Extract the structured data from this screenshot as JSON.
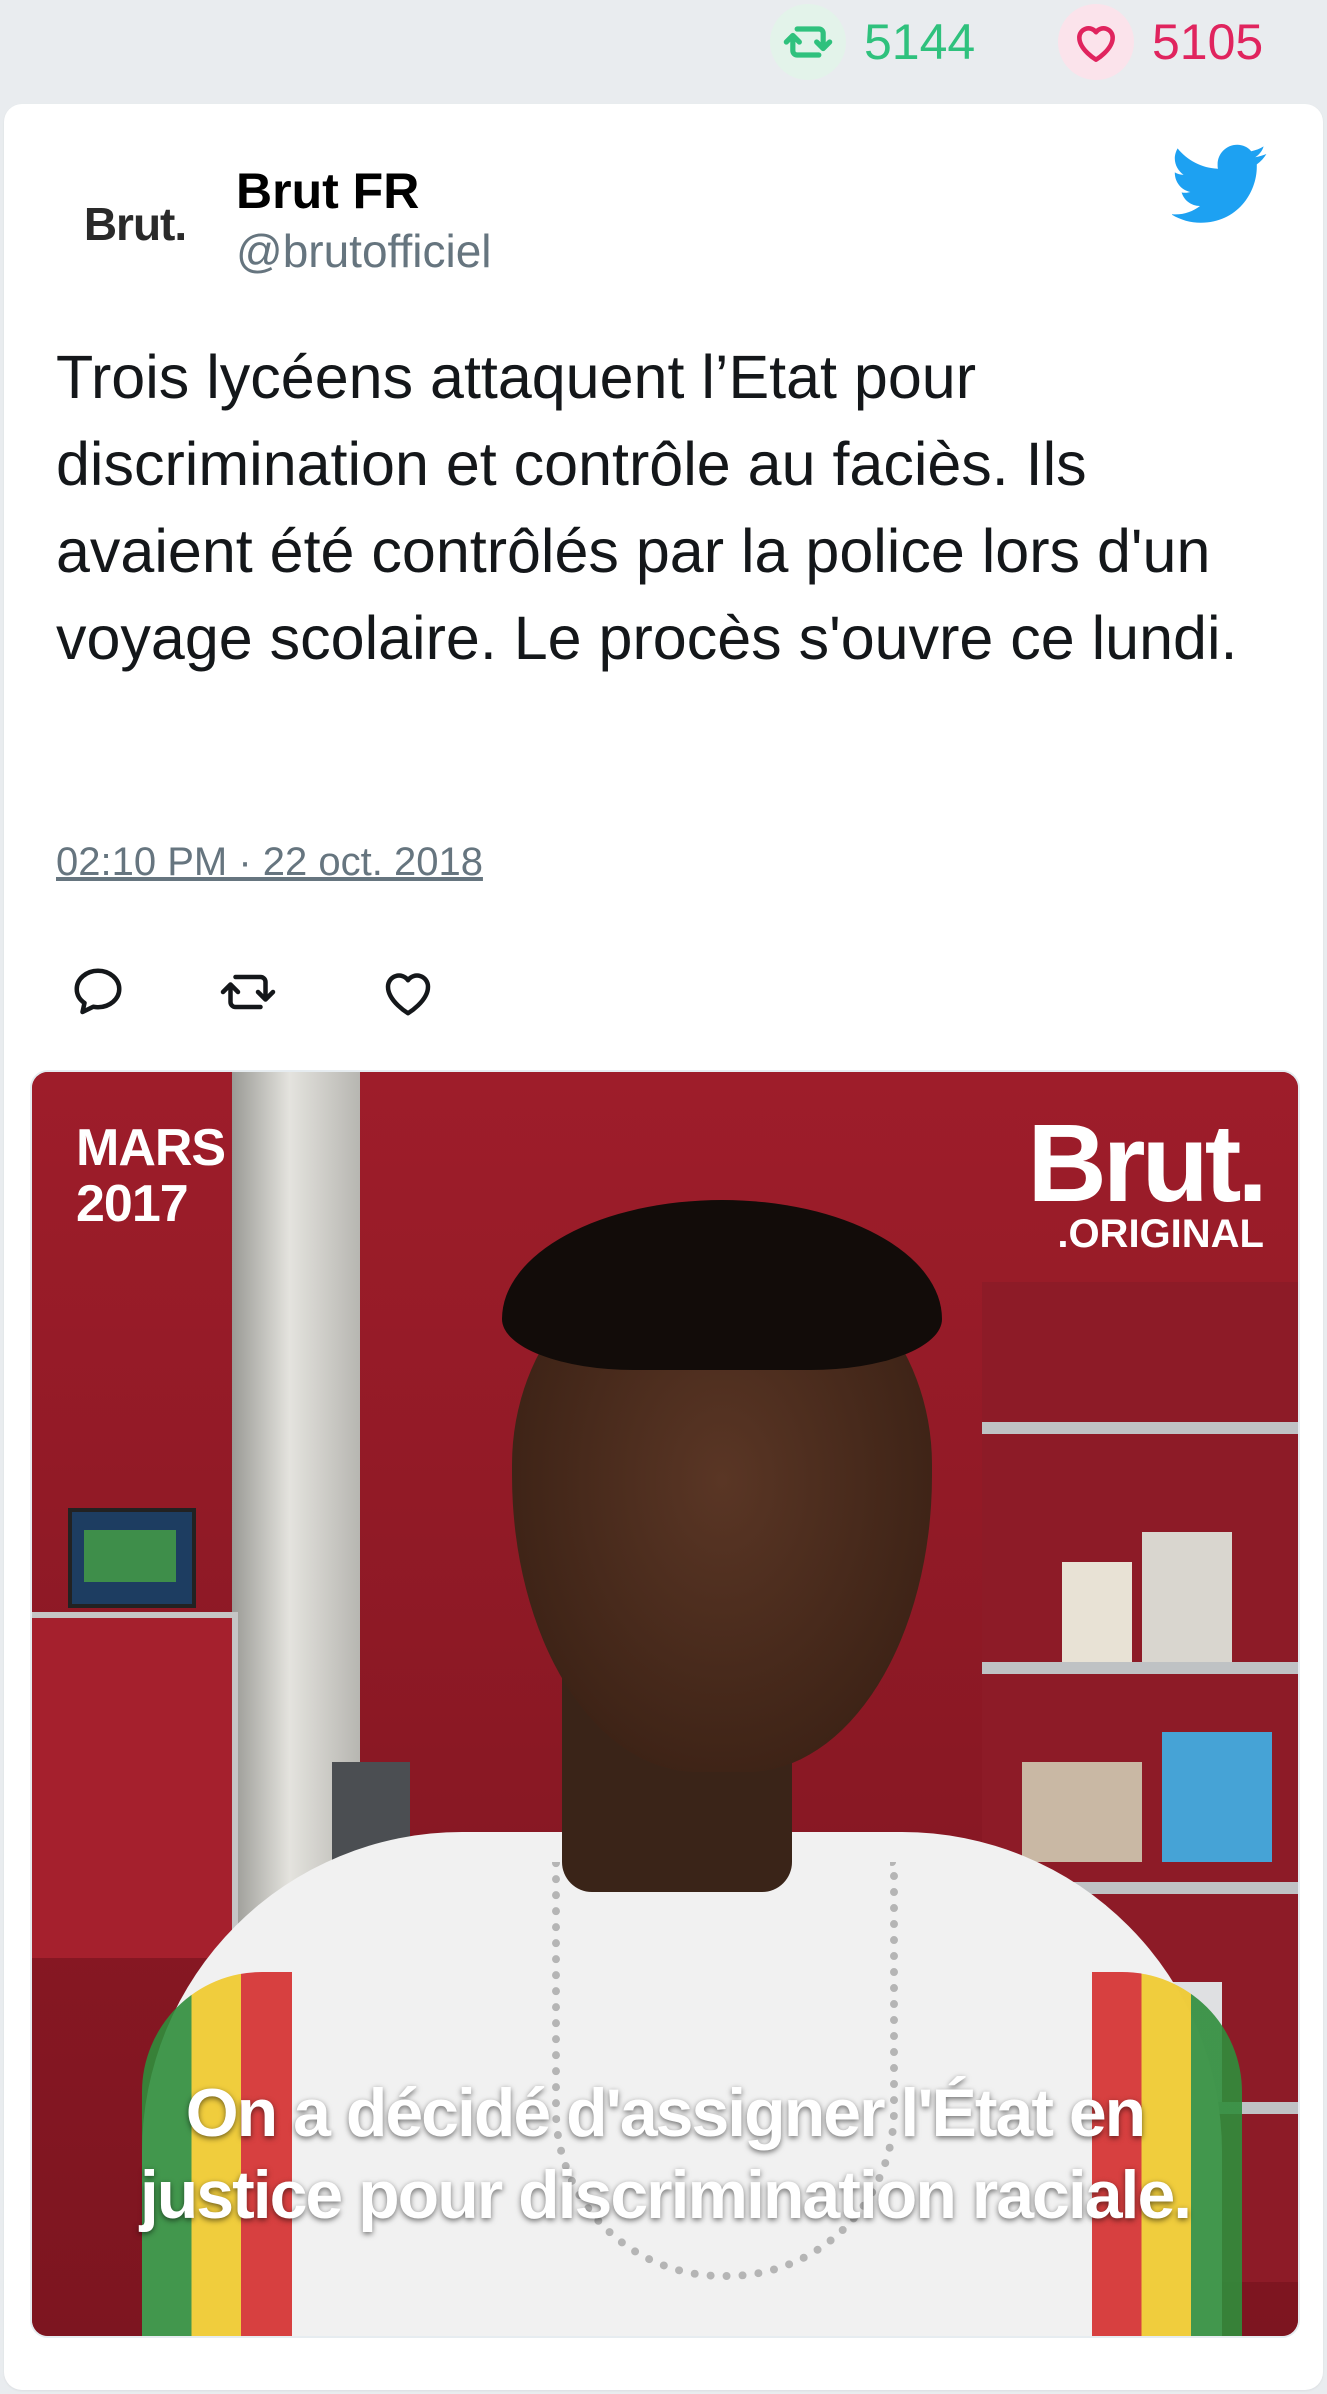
{
  "stats": {
    "retweets": "5144",
    "likes": "5105",
    "retweet_color": "#2fc17d",
    "like_color": "#e0245e"
  },
  "tweet": {
    "avatar_text": "Brut.",
    "user_name": "Brut FR",
    "user_handle": "@brutofficiel",
    "text": "Trois lycéens attaquent l’Etat pour discrimination et contrôle au faciès. Ils avaient été contrôlés par la police lors d'un voyage scolaire. Le procès s'ouvre ce lundi.",
    "timestamp": "02:10 PM · 22 oct. 2018",
    "brand_icon": "twitter-bird-icon",
    "brand_color": "#1da1f2"
  },
  "actions": [
    {
      "name": "reply",
      "icon": "reply-icon"
    },
    {
      "name": "retweet",
      "icon": "retweet-icon"
    },
    {
      "name": "like",
      "icon": "heart-icon"
    }
  ],
  "media": {
    "date_line1": "MARS",
    "date_line2": "2017",
    "logo_main": "Brut.",
    "logo_sub": ".ORIGINAL",
    "caption_line1": "On a décidé d'assigner l'État en",
    "caption_line2": "justice pour discrimination raciale."
  }
}
